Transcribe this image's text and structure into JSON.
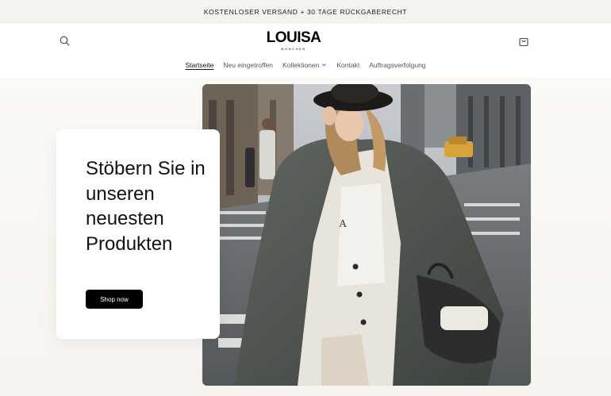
{
  "announcement": {
    "text": "KOSTENLOSER VERSAND + 30 TAGE RÜCKGABERECHT"
  },
  "header": {
    "logo_main": "LOUISA",
    "logo_sub": "MÜNCHEN",
    "search_icon": "search-icon",
    "cart_icon": "shopping-bag-icon"
  },
  "nav": {
    "items": [
      {
        "label": "Startseite",
        "active": true
      },
      {
        "label": "Neu eingetroffen",
        "active": false
      },
      {
        "label": "Kollektionen",
        "active": false,
        "has_dropdown": true
      },
      {
        "label": "Kontakt",
        "active": false
      },
      {
        "label": "Auftragsverfolgung",
        "active": false
      }
    ],
    "dropdown_icon": "chevron-down-icon"
  },
  "hero": {
    "title": "Stöbern Sie in unseren neuesten Produkten",
    "cta_label": "Shop now",
    "image_description_icon": "hero-photo",
    "overlay_text": "A"
  },
  "colors": {
    "announcement_bg": "#f5f3f0",
    "button_bg": "#000000",
    "text": "#121212",
    "nav_text": "#555555"
  }
}
